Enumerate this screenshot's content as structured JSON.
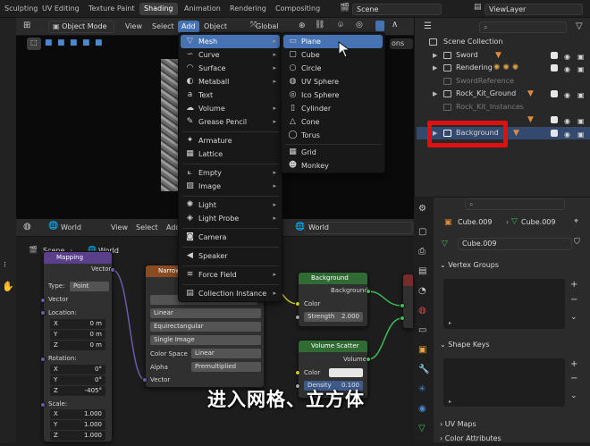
{
  "workspace_tabs": [
    "Sculpting",
    "UV Editing",
    "Texture Paint",
    "Shading",
    "Animation",
    "Rendering",
    "Compositing"
  ],
  "active_tab": "Shading",
  "scene_field": "Scene",
  "viewlayer_field": "ViewLayer",
  "viewport_header": {
    "mode": "Object Mode",
    "menus": [
      "View",
      "Select",
      "Add",
      "Object"
    ],
    "orientation": "Global",
    "options_label": "ons"
  },
  "add_menu": {
    "items": [
      {
        "label": "Mesh",
        "icon": "mesh-icon",
        "submenu": true
      },
      {
        "label": "Curve",
        "icon": "curve-icon",
        "submenu": true
      },
      {
        "label": "Surface",
        "icon": "surface-icon",
        "submenu": true
      },
      {
        "label": "Metaball",
        "icon": "metaball-icon",
        "submenu": true
      },
      {
        "label": "Text",
        "icon": "text-icon",
        "submenu": false
      },
      {
        "label": "Volume",
        "icon": "volume-icon",
        "submenu": true
      },
      {
        "label": "Grease Pencil",
        "icon": "grease-pencil-icon",
        "submenu": true
      },
      {
        "label": "Armature",
        "icon": "armature-icon",
        "submenu": false
      },
      {
        "label": "Lattice",
        "icon": "lattice-icon",
        "submenu": false
      },
      {
        "label": "Empty",
        "icon": "empty-icon",
        "submenu": true
      },
      {
        "label": "Image",
        "icon": "image-icon",
        "submenu": true
      },
      {
        "label": "Light",
        "icon": "light-icon",
        "submenu": true
      },
      {
        "label": "Light Probe",
        "icon": "light-probe-icon",
        "submenu": true
      },
      {
        "label": "Camera",
        "icon": "camera-icon",
        "submenu": false
      },
      {
        "label": "Speaker",
        "icon": "speaker-icon",
        "submenu": false
      },
      {
        "label": "Force Field",
        "icon": "force-field-icon",
        "submenu": true
      },
      {
        "label": "Collection Instance",
        "icon": "collection-instance-icon",
        "submenu": true
      }
    ]
  },
  "mesh_submenu": {
    "items": [
      "Plane",
      "Cube",
      "Circle",
      "UV Sphere",
      "Ico Sphere",
      "Cylinder",
      "Cone",
      "Torus",
      "Grid",
      "Monkey"
    ]
  },
  "outliner": {
    "rows": [
      {
        "label": "Scene Collection"
      },
      {
        "label": "Sword"
      },
      {
        "label": "Rendering"
      },
      {
        "label": "SwordReference"
      },
      {
        "label": "Rock_Kit_Ground"
      },
      {
        "label": "Rock_Kit_Instances"
      },
      {
        "label": ""
      },
      {
        "label": "Background"
      }
    ]
  },
  "node_editor": {
    "header_world": "World",
    "menus": [
      "View",
      "Select",
      "Add"
    ],
    "breadcrumb_scene": "Scene",
    "breadcrumb_world": "World",
    "world_field": "World",
    "mapping": {
      "title": "Mapping",
      "out": "Vector",
      "type_label": "Type:",
      "type_value": "Point",
      "in_vector": "Vector",
      "location": "Location:",
      "loc": [
        [
          "X",
          "0 m"
        ],
        [
          "Y",
          "0 m"
        ],
        [
          "Z",
          "0 m"
        ]
      ],
      "rotation": "Rotation:",
      "rot": [
        [
          "X",
          "0°"
        ],
        [
          "Y",
          "0°"
        ],
        [
          "Z",
          "-405°"
        ]
      ],
      "scale": "Scale:",
      "scl": [
        [
          "X",
          "1.000"
        ],
        [
          "Y",
          "1.000"
        ],
        [
          "Z",
          "1.000"
        ]
      ]
    },
    "env_texture": {
      "title": "Narrow",
      "options": [
        "Linear",
        "Equirectangular",
        "Single Image"
      ],
      "colorspace_label": "Color Space",
      "colorspace_value": "Linear",
      "alpha_label": "Alpha",
      "alpha_value": "Premultiplied",
      "in_vector": "Vector"
    },
    "background": {
      "title": "Background",
      "out": "Background",
      "color": "Color",
      "strength_label": "Strength",
      "strength_value": "2.000"
    },
    "volume_scatter": {
      "title": "Volume Scatter",
      "out": "Volume",
      "color": "Color",
      "density_label": "Density",
      "density_value": "0.100"
    }
  },
  "properties": {
    "object_name": "Cube.009",
    "mesh_name": "Cube.009",
    "data_field": "Cube.009",
    "panels": [
      "Vertex Groups",
      "Shape Keys",
      "UV Maps",
      "Color Attributes"
    ]
  },
  "caption": "进入网格、立方体",
  "colors": {
    "accent": "#4772b3",
    "highlight_box": "#e01010",
    "node_green": "#2f6b32",
    "node_purple": "#5a3f8a",
    "node_orange": "#8a4a22"
  }
}
